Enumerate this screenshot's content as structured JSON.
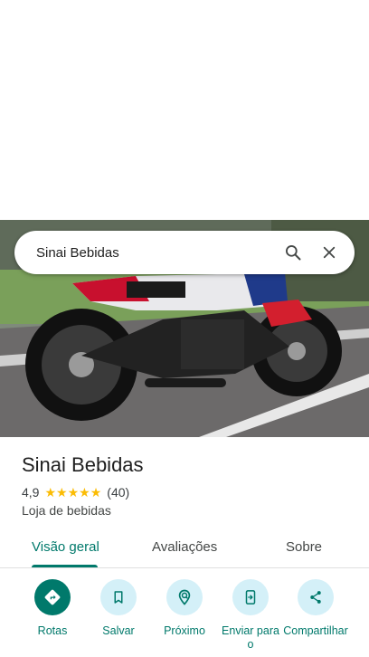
{
  "search": {
    "query": "Sinai Bebidas"
  },
  "place": {
    "name": "Sinai Bebidas",
    "rating": "4,9",
    "reviews_count": "(40)",
    "star_count": 5,
    "category": "Loja de bebidas"
  },
  "tabs": [
    {
      "label": "Visão geral",
      "active": true
    },
    {
      "label": "Avaliações",
      "active": false
    },
    {
      "label": "Sobre",
      "active": false
    }
  ],
  "actions": [
    {
      "label": "Rotas",
      "icon": "directions-icon"
    },
    {
      "label": "Salvar",
      "icon": "bookmark-icon"
    },
    {
      "label": "Próximo",
      "icon": "nearby-icon"
    },
    {
      "label": "Enviar para o",
      "icon": "send-to-phone-icon"
    },
    {
      "label": "Compartilhar",
      "icon": "share-icon"
    }
  ],
  "colors": {
    "accent": "#00796b",
    "action_bg": "#d4f0f8",
    "star": "#fbbc04"
  }
}
